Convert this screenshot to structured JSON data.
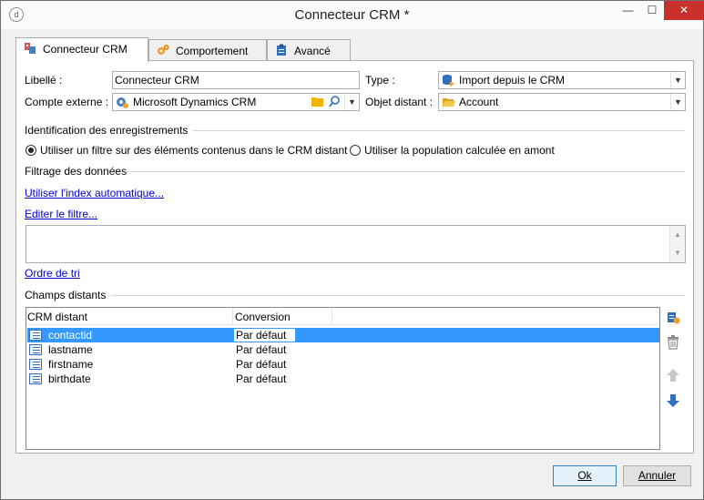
{
  "window": {
    "title": "Connecteur CRM *",
    "minimize_label": "—",
    "maximize_label": "☐",
    "close_label": "✕"
  },
  "tabs": [
    {
      "label": "Connecteur CRM",
      "icon": "crm-connector-icon",
      "active": true
    },
    {
      "label": "Comportement",
      "icon": "gears-icon",
      "active": false
    },
    {
      "label": "Avancé",
      "icon": "clipboard-icon",
      "active": false
    }
  ],
  "form": {
    "libelle_label": "Libellé :",
    "libelle_value": "Connecteur CRM",
    "compte_label": "Compte externe :",
    "compte_value": "Microsoft Dynamics CRM",
    "type_label": "Type :",
    "type_value": "Import depuis le CRM",
    "objet_label": "Objet distant :",
    "objet_value": "Account"
  },
  "identification": {
    "heading": "Identification des enregistrements",
    "option1": "Utiliser un filtre sur des éléments contenus dans le CRM distant",
    "option2": "Utiliser la population calculée en amont",
    "selected": 1
  },
  "filtrage": {
    "heading": "Filtrage des données",
    "link_index": "Utiliser l'index automatique...",
    "link_filter": "Editer le filtre...",
    "filter_text": "",
    "link_sort": "Ordre de tri"
  },
  "champs": {
    "heading": "Champs distants",
    "columns": [
      "CRM distant",
      "Conversion"
    ],
    "rows": [
      {
        "name": "contactid",
        "conversion": "Par défaut",
        "selected": true
      },
      {
        "name": "lastname",
        "conversion": "Par défaut",
        "selected": false
      },
      {
        "name": "firstname",
        "conversion": "Par défaut",
        "selected": false
      },
      {
        "name": "birthdate",
        "conversion": "Par défaut",
        "selected": false
      }
    ]
  },
  "buttons": {
    "ok": "Ok",
    "cancel": "Annuler"
  },
  "colors": {
    "selection": "#3399ff",
    "link": "#0000cc",
    "close": "#c7302b"
  }
}
